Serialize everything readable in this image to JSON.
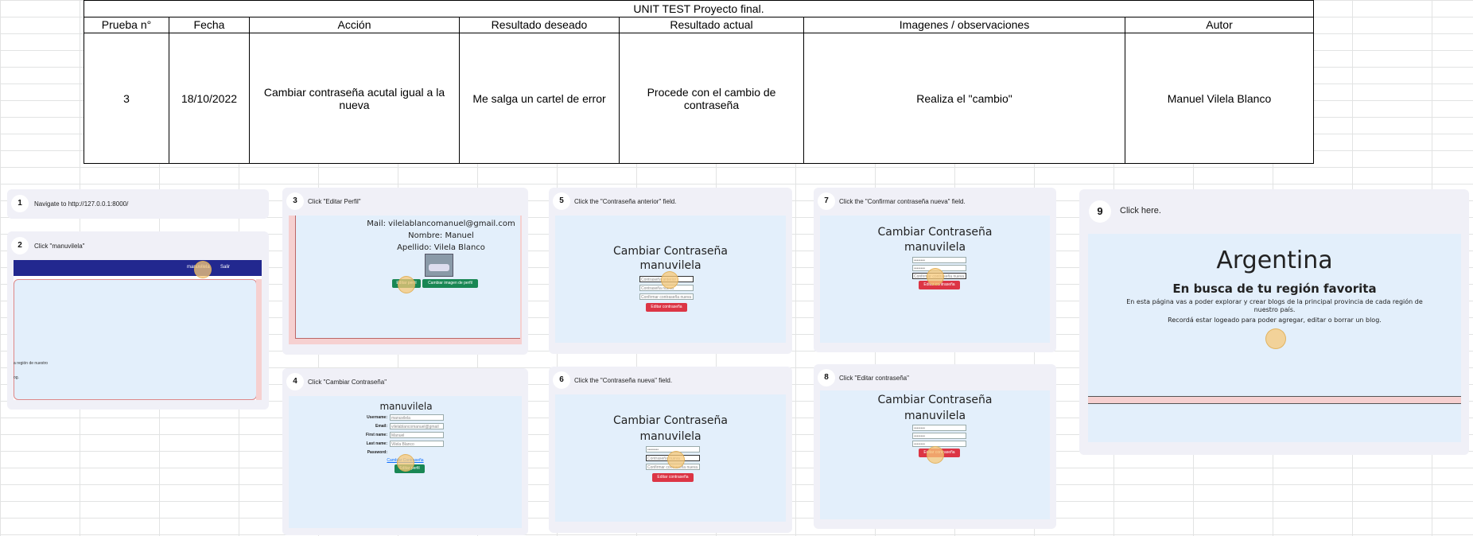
{
  "sheet": {
    "caption": "UNIT TEST Proyecto final.",
    "headers": {
      "prueba": "Prueba n°",
      "fecha": "Fecha",
      "accion": "Acción",
      "resultado_deseado": "Resultado deseado",
      "resultado_actual": "Resultado actual",
      "imagenes": "Imagenes / observaciones",
      "autor": "Autor"
    },
    "row": {
      "prueba": "3",
      "fecha": "18/10/2022",
      "accion": "Cambiar contraseña acutal igual a la nueva",
      "resultado_deseado": "Me salga un cartel de error",
      "resultado_actual": "Procede con el cambio de contraseña",
      "imagenes": "Realiza el \"cambio\"",
      "autor": "Manuel Vilela Blanco"
    }
  },
  "steps": {
    "s1": {
      "num": "1",
      "text": "Navigate to http://127.0.0.1:8000/"
    },
    "s2": {
      "num": "2",
      "text": "Click \"manuvilela\"",
      "nav_user": "manuvilela",
      "nav_exit": "Salir",
      "frag1": "a región de nuestro",
      "frag2": "og."
    },
    "s3": {
      "num": "3",
      "text": "Click \"Editar Perfil\"",
      "mail": "Mail: vilelablancomanuel@gmail.com",
      "nombre": "Nombre: Manuel",
      "apellido": "Apellido: Vilela Blanco",
      "btn_edit": "Editar perfil",
      "btn_img": "Cambiar imagen de perfil"
    },
    "s4": {
      "num": "4",
      "text": "Click \"Cambiar Contraseña\"",
      "title": "manuvilela",
      "lbl_user": "Username:",
      "val_user": "manuvilela",
      "lbl_email": "Email:",
      "val_email": "vilelablancomanuel@gmail",
      "lbl_first": "First name:",
      "val_first": "Manuel",
      "lbl_last": "Last name:",
      "val_last": "Vilela Blanco",
      "lbl_pass": "Password:",
      "link": "Cambiar Contraseña",
      "btn": "Editar perfil"
    },
    "s5": {
      "num": "5",
      "text": "Click the \"Contraseña anterior\" field.",
      "title": "Cambiar Contraseña",
      "user": "manuvilela",
      "ph1": "Contraseña anterior",
      "ph2": "Contraseña nueva",
      "ph3": "Confirmar contraseña nueva",
      "btn": "Editar contraseña"
    },
    "s6": {
      "num": "6",
      "text": "Click the \"Contraseña nueva\" field.",
      "title": "Cambiar Contraseña",
      "user": "manuvilela",
      "v1": "••••••••",
      "ph2": "Contraseña nueva",
      "ph3": "Confirmar contraseña nueva",
      "btn": "Editar contraseña"
    },
    "s7": {
      "num": "7",
      "text": "Click the \"Confirmar contraseña nueva\" field.",
      "title": "Cambiar Contraseña",
      "user": "manuvilela",
      "v1": "••••••••",
      "v2": "••••••••",
      "ph3": "Confirmar contraseña nueva",
      "btn": "Editar contraseña"
    },
    "s8": {
      "num": "8",
      "text": "Click \"Editar contraseña\"",
      "title": "Cambiar Contraseña",
      "user": "manuvilela",
      "v1": "••••••••",
      "v2": "••••••••",
      "v3": "••••••••",
      "btn": "Editar contraseña"
    },
    "s9": {
      "num": "9",
      "text": "Click here.",
      "title": "Argentina",
      "subtitle": "En busca de tu región favorita",
      "p1": "En esta página vas a poder explorar y crear blogs de la principal provincia de cada región de nuestro país.",
      "p2": "Recordá estar logeado para poder agregar, editar o borrar un blog."
    }
  }
}
